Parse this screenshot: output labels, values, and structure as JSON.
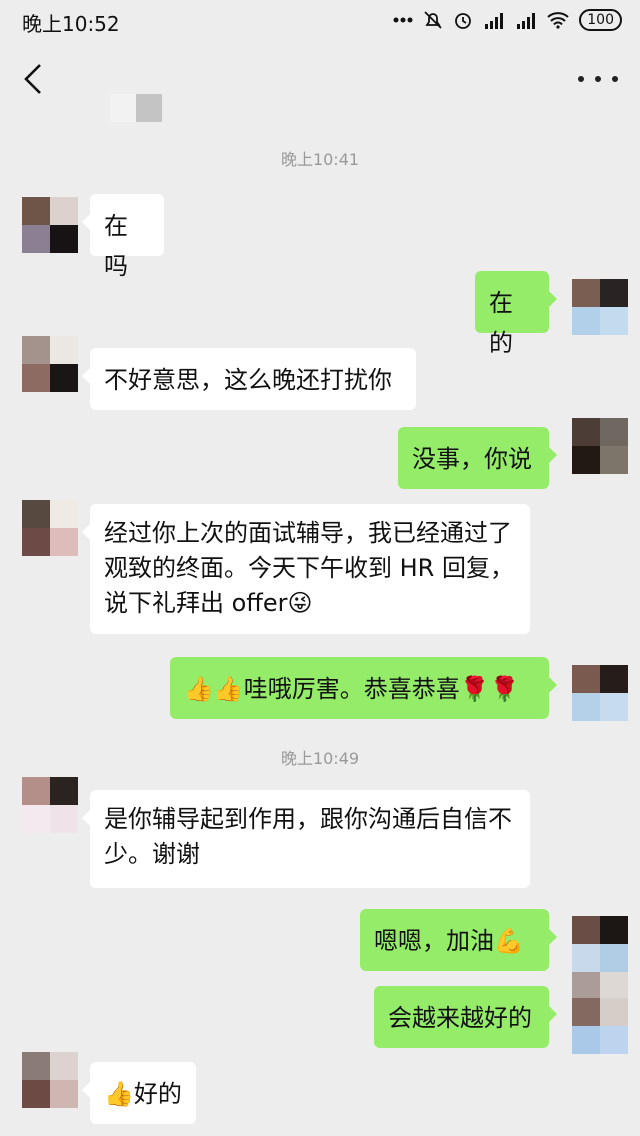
{
  "status_bar": {
    "time": "晚上10:52",
    "battery": "100"
  },
  "nav": {
    "more_glyph": "···"
  },
  "timestamps": [
    "晚上10:41",
    "晚上10:49"
  ],
  "messages": [
    {
      "side": "left",
      "text": "在吗"
    },
    {
      "side": "right",
      "text": "在的"
    },
    {
      "side": "left",
      "text": "不好意思，这么晚还打扰你"
    },
    {
      "side": "right",
      "text": "没事，你说"
    },
    {
      "side": "left",
      "line1": "经过你上次的面试辅导，我已经通过了",
      "line2": "观致的终面。今天下午收到 HR 回复，",
      "line3": "说下礼拜出 offer",
      "emoji": "😜"
    },
    {
      "side": "right",
      "emoji_lead": "👍👍",
      "text": "哇哦厉害。恭喜恭喜",
      "emoji_trail": "🌹🌹"
    },
    {
      "side": "left",
      "line1": "是你辅导起到作用，跟你沟通后自信不",
      "line2": "少。谢谢"
    },
    {
      "side": "right",
      "text": "嗯嗯，加油",
      "emoji": "💪"
    },
    {
      "side": "right",
      "text": "会越来越好的"
    },
    {
      "side": "left",
      "emoji": "👍",
      "text": "好的"
    }
  ],
  "colors": {
    "background": "#ededed",
    "bubble_left": "#ffffff",
    "bubble_right": "#95ec69",
    "timestamp": "#999999"
  }
}
